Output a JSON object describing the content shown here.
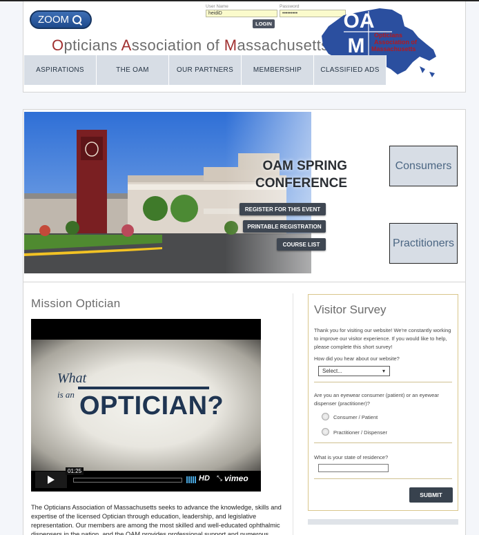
{
  "header": {
    "zoom_label": "ZOOM",
    "login": {
      "username_label": "User Name",
      "username_value": "heidiD",
      "password_label": "Password",
      "password_value": "•••••••••",
      "login_button": "LOGIN"
    },
    "site_title": {
      "o": "O",
      "pticians": "pticians ",
      "a": "A",
      "ssociation": "ssociation of ",
      "m": "M",
      "assachusetts": "assachusetts"
    },
    "logo": {
      "letters_top": "OA",
      "letter_bottom": "M",
      "line1": "Opticians",
      "line2": "Association of",
      "line3": "Massachusetts"
    }
  },
  "nav": {
    "items": [
      "ASPIRATIONS",
      "THE OAM",
      "OUR PARTNERS",
      "MEMBERSHIP",
      "CLASSIFIED ADS"
    ]
  },
  "hero": {
    "title_line1": "OAM SPRING",
    "title_line2": "CONFERENCE",
    "buttons": [
      "REGISTER FOR THIS EVENT",
      "PRINTABLE REGISTRATION",
      "COURSE LIST"
    ],
    "side_buttons": [
      "Consumers",
      "Practitioners"
    ]
  },
  "mission": {
    "title": "Mission Optician",
    "video": {
      "title_what": "What",
      "title_is_an": "is an",
      "title_main": "OPTICIAN?",
      "time": "01:25",
      "hd_label": "HD",
      "brand": "vimeo"
    },
    "text": "The Opticians Association of Massachusetts seeks to advance the knowledge, skills and expertise of the licensed Optician through education, leadership, and legislative representation. Our members are among the most skilled and well-educated ophthalmic dispensers in the nation, and the OAM provides professional support and numerous"
  },
  "survey": {
    "title": "Visitor Survey",
    "intro": "Thank you for visiting our website! We're constantly working to improve our visitor experience. If you would like to help, please complete this short survey!",
    "q1": "How did you hear about our website?",
    "q1_select": "Select...",
    "q2": "Are you an eyewear consumer (patient) or an eyewear dispenser (practitioner)?",
    "q2_opt1": "Consumer / Patient",
    "q2_opt2": "Practitioner / Dispenser",
    "q3": "What is your state of residence?",
    "submit": "SUBMIT"
  },
  "colors": {
    "nav_bg": "#d7dde5",
    "nav_text": "#263545",
    "logo_blue": "#2b4f9f",
    "logo_red": "#b3191f",
    "survey_border": "#d9c68a",
    "button_dark": "#3f4752"
  }
}
